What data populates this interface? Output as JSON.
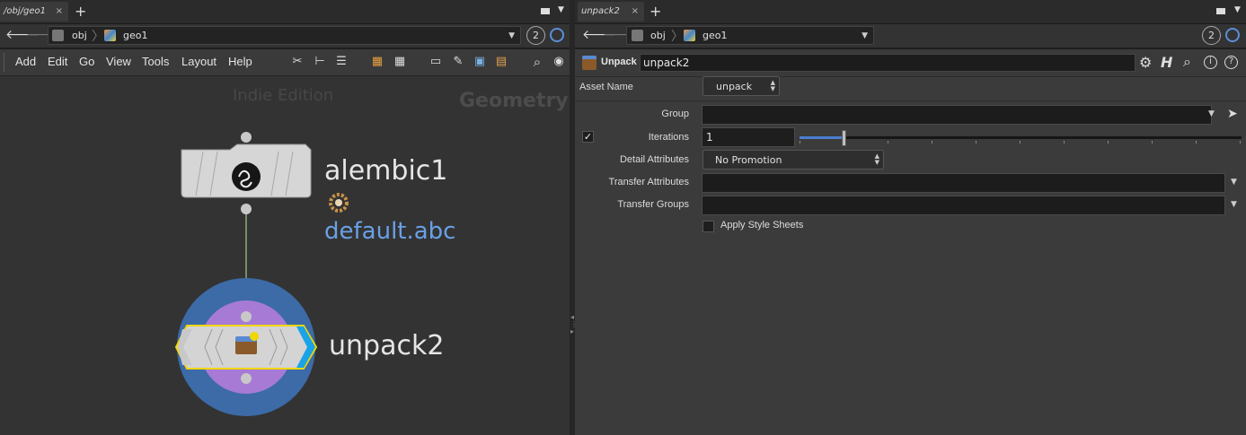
{
  "left": {
    "tab": {
      "label": "/obj/geo1",
      "close": "×"
    },
    "add_tab": "+",
    "path": {
      "root": "obj",
      "node": "geo1"
    },
    "desktop_count": "2",
    "menu": [
      "Add",
      "Edit",
      "Go",
      "View",
      "Tools",
      "Layout",
      "Help"
    ],
    "network": {
      "watermark": "Indie Edition",
      "context_label": "Geometry",
      "nodes": [
        {
          "name": "alembic1",
          "comment": "default.abc"
        },
        {
          "name": "unpack2"
        }
      ]
    }
  },
  "right": {
    "tab": {
      "label": "unpack2",
      "close": "×"
    },
    "add_tab": "+",
    "path": {
      "root": "obj",
      "node": "geo1"
    },
    "desktop_count": "2",
    "node_type": "Unpack",
    "node_name": "unpack2",
    "params": {
      "asset_name": {
        "label": "Asset Name",
        "value": "unpack"
      },
      "group": {
        "label": "Group",
        "value": ""
      },
      "iterations": {
        "label": "Iterations",
        "value": "1",
        "enabled": true,
        "slider_fraction": 0.1
      },
      "detail_attributes": {
        "label": "Detail Attributes",
        "value": "No Promotion"
      },
      "transfer_attributes": {
        "label": "Transfer Attributes",
        "value": ""
      },
      "transfer_groups": {
        "label": "Transfer Groups",
        "value": ""
      },
      "apply_style_sheets": {
        "label": "Apply Style Sheets",
        "checked": false
      }
    }
  },
  "colors": {
    "accent_blue": "#6aa0e6",
    "node_ring": "#3b6fb3",
    "node_purple": "#a06fd8",
    "selected_yellow": "#f2d600",
    "flag_blue": "#1aa3e8"
  }
}
